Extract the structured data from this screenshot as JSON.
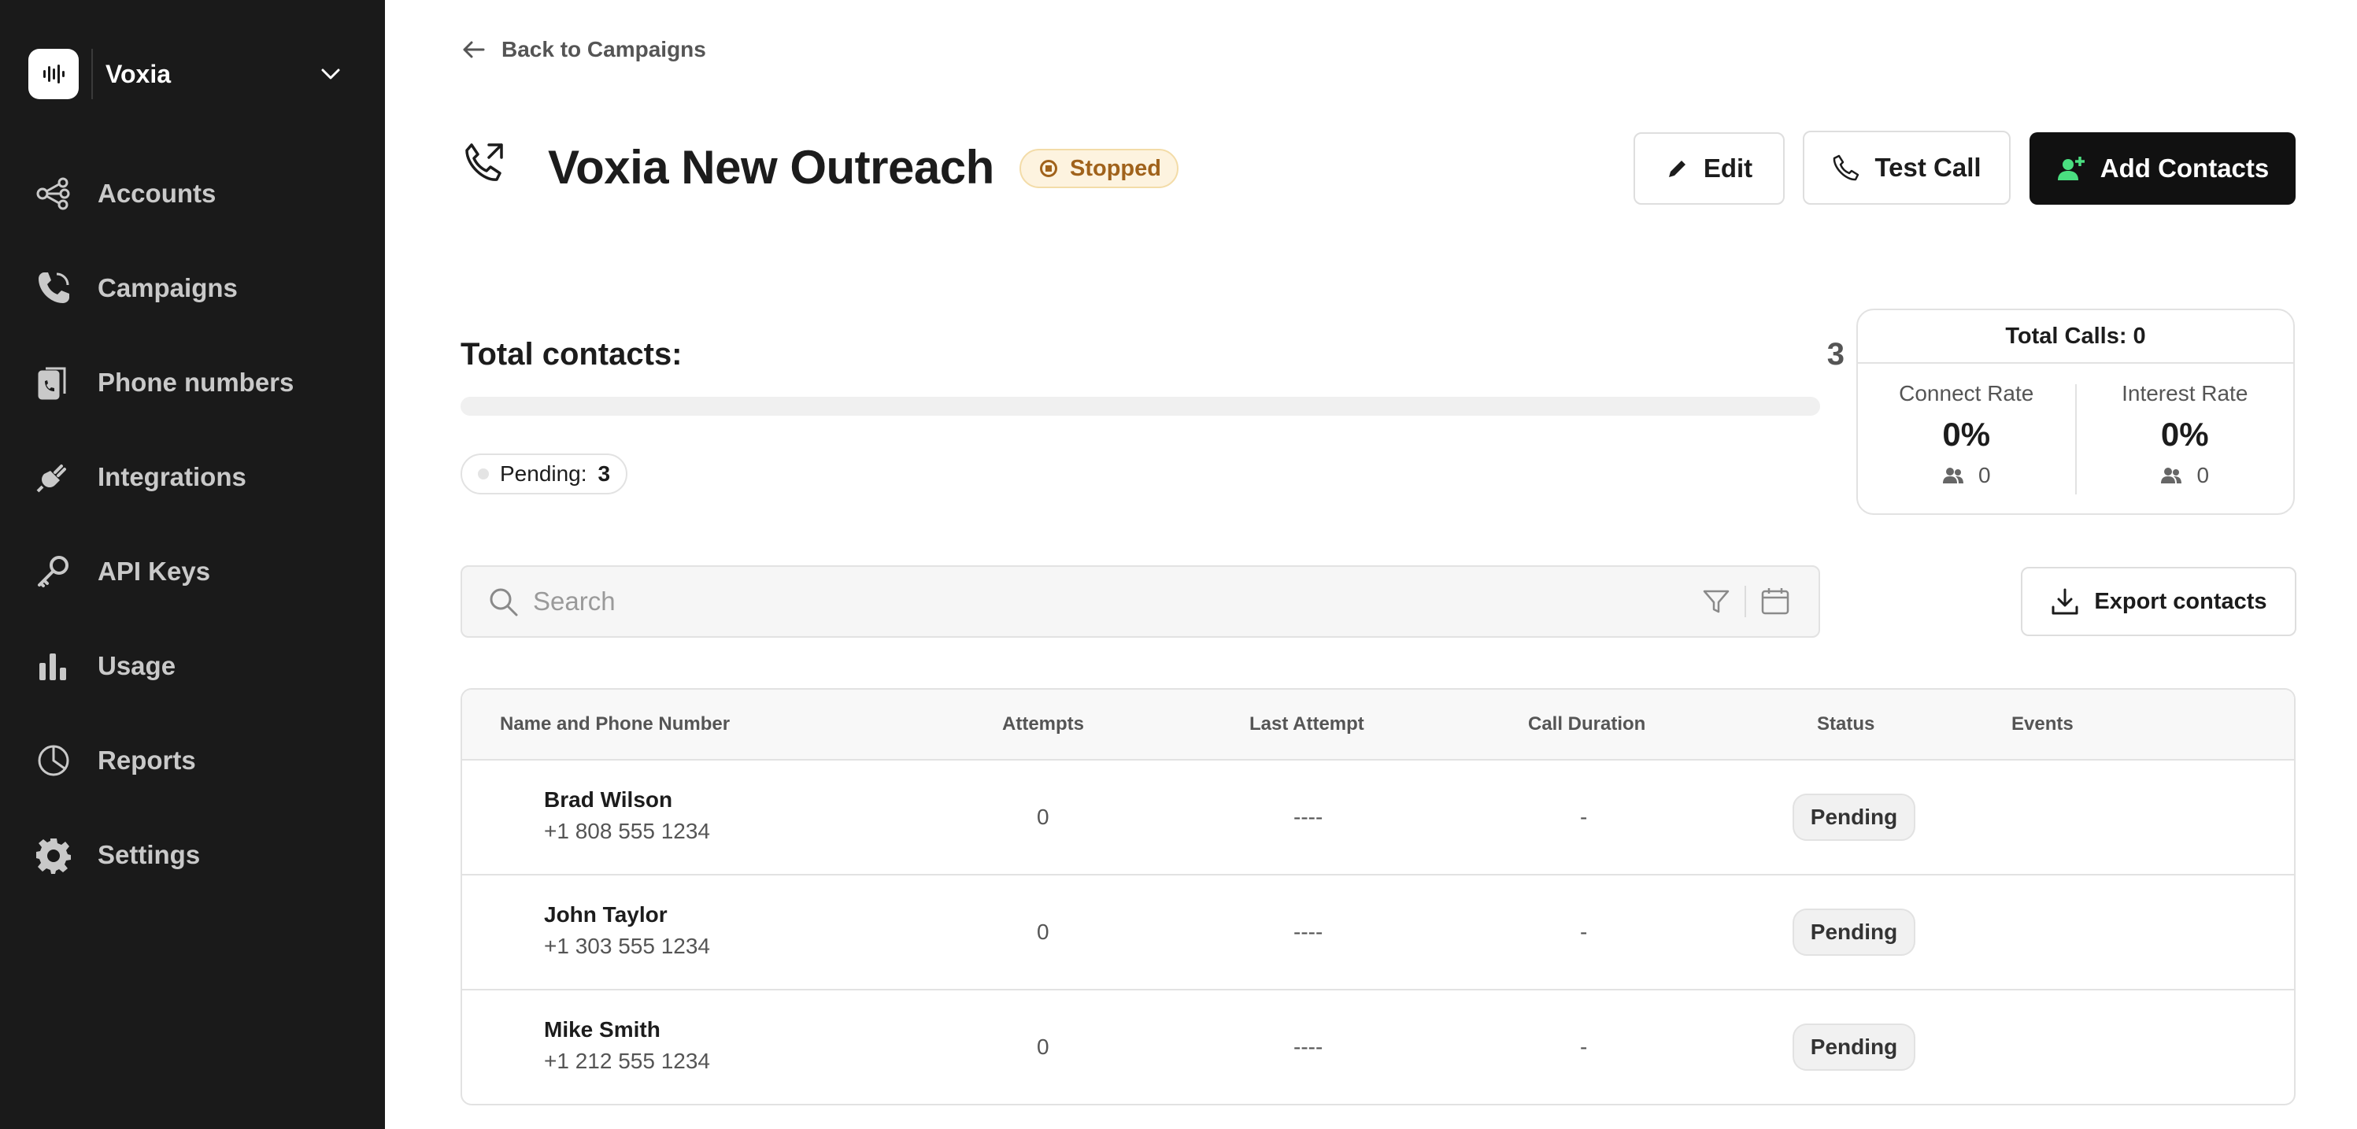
{
  "brand": {
    "name": "Voxia"
  },
  "sidebar": {
    "items": [
      {
        "label": "Accounts",
        "icon": "accounts-icon"
      },
      {
        "label": "Campaigns",
        "icon": "campaigns-icon"
      },
      {
        "label": "Phone numbers",
        "icon": "phone-numbers-icon"
      },
      {
        "label": "Integrations",
        "icon": "integrations-icon"
      },
      {
        "label": "API Keys",
        "icon": "key-icon"
      },
      {
        "label": "Usage",
        "icon": "usage-icon"
      },
      {
        "label": "Reports",
        "icon": "reports-icon"
      },
      {
        "label": "Settings",
        "icon": "gear-icon"
      }
    ]
  },
  "nav": {
    "back_label": "Back to Campaigns"
  },
  "campaign": {
    "title": "Voxia New Outreach",
    "status": "Stopped",
    "status_color": "#a0621b"
  },
  "actions": {
    "edit_label": "Edit",
    "test_call_label": "Test Call",
    "add_contacts_label": "Add Contacts"
  },
  "summary": {
    "total_contacts_label": "Total contacts:",
    "total_contacts_value": "3",
    "progress_fraction": 0,
    "pending_label": "Pending:",
    "pending_value": "3"
  },
  "stats": {
    "total_calls_label": "Total Calls: 0",
    "connect_rate_label": "Connect Rate",
    "connect_rate_value": "0%",
    "connect_count": "0",
    "interest_rate_label": "Interest Rate",
    "interest_rate_value": "0%",
    "interest_count": "0"
  },
  "search": {
    "placeholder": "Search"
  },
  "export": {
    "label": "Export contacts"
  },
  "table": {
    "headers": {
      "name": "Name and Phone Number",
      "attempts": "Attempts",
      "last_attempt": "Last Attempt",
      "call_duration": "Call Duration",
      "status": "Status",
      "events": "Events"
    },
    "rows": [
      {
        "name": "Brad Wilson",
        "phone": "+1 808 555 1234",
        "attempts": "0",
        "last_attempt": "----",
        "duration": "-",
        "status": "Pending"
      },
      {
        "name": "John Taylor",
        "phone": "+1 303 555 1234",
        "attempts": "0",
        "last_attempt": "----",
        "duration": "-",
        "status": "Pending"
      },
      {
        "name": "Mike Smith",
        "phone": "+1 212 555 1234",
        "attempts": "0",
        "last_attempt": "----",
        "duration": "-",
        "status": "Pending"
      }
    ]
  },
  "colors": {
    "sidebar_bg": "#1a1a1a",
    "accent_green": "#4ade80",
    "primary_dark": "#111111"
  }
}
